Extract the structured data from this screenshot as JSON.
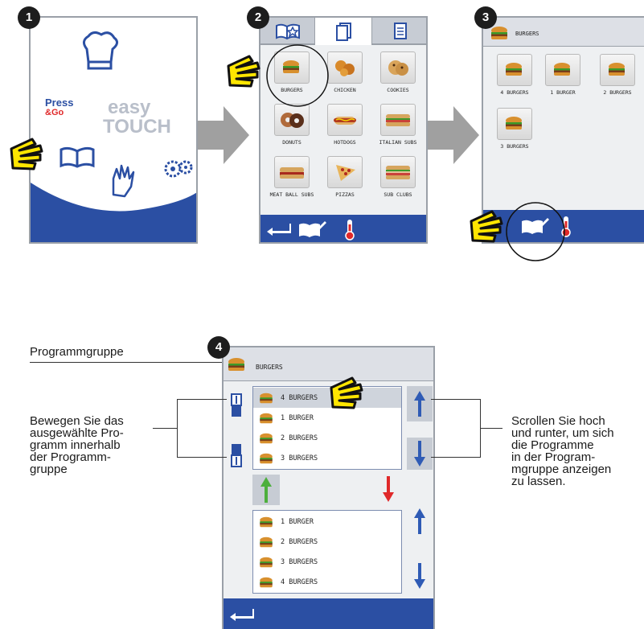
{
  "screen1": {
    "brand_press": "Press",
    "brand_go": "&Go",
    "brand_easy": "easy",
    "brand_touch": "TOUCH"
  },
  "screen2": {
    "items": [
      "BURGERS",
      "CHICKEN",
      "COOKIES",
      "DONUTS",
      "HOTDOGS",
      "ITALIAN SUBS",
      "MEAT BALL SUBS",
      "PIZZAS",
      "SUB CLUBS"
    ]
  },
  "screen3": {
    "header": "BURGERS",
    "items": [
      "4 BURGERS",
      "1 BURGER",
      "2 BURGERS",
      "3 BURGERS"
    ]
  },
  "screen4": {
    "header": "BURGERS",
    "top_list": [
      "4 BURGERS",
      "1 BURGER",
      "2 BURGERS",
      "3 BURGERS"
    ],
    "bottom_list": [
      "1 BURGER",
      "2 BURGERS",
      "3 BURGERS",
      "4 BURGERS"
    ]
  },
  "steps": [
    "1",
    "2",
    "3",
    "4"
  ],
  "callouts": {
    "group": "Programmgruppe",
    "move": [
      "Bewegen Sie das",
      "ausgewählte Pro-",
      "gramm innerhalb",
      "der Programm-",
      "gruppe"
    ],
    "scroll": [
      "Scrollen Sie hoch",
      "und runter, um sich",
      "die Programme",
      "in der Program-",
      "mgruppe anzeigen",
      "zu lassen."
    ]
  },
  "colors": {
    "bar_blue": "#2b4fa3",
    "arrow_blue": "#2f5bb5",
    "arrow_red": "#e0292a",
    "arrow_green": "#4caf3c",
    "hand_yellow": "#ffe600"
  }
}
